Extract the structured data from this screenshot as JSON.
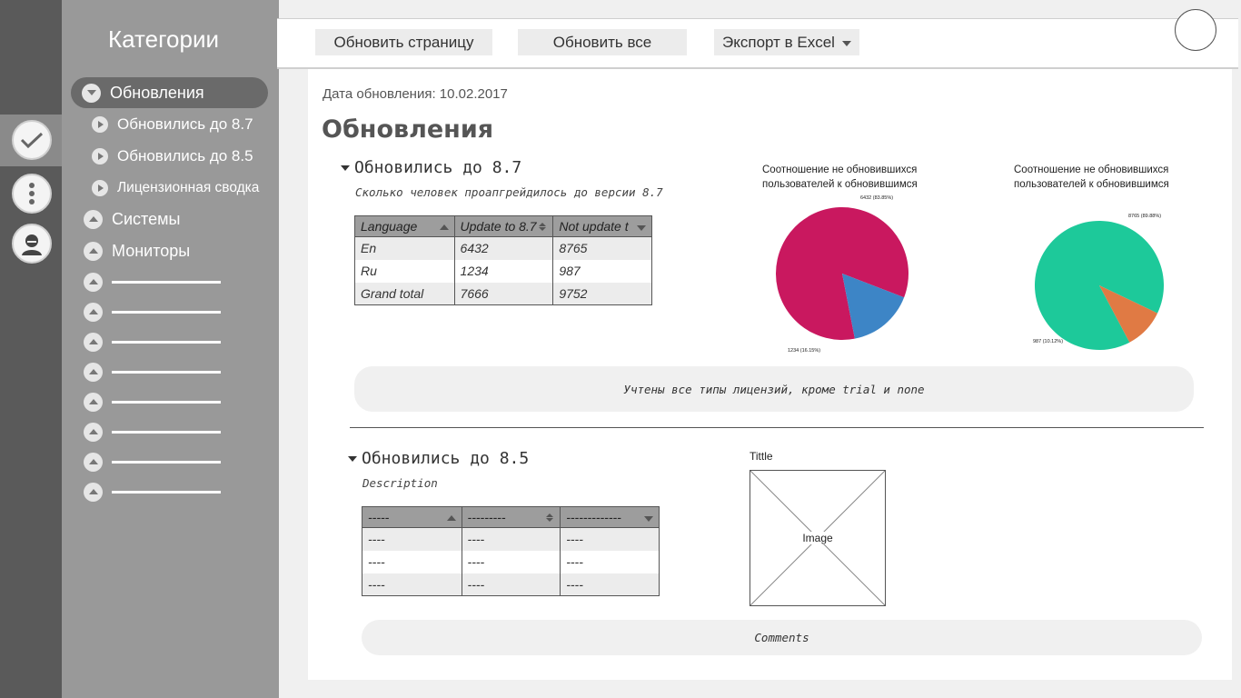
{
  "icons": {
    "rail": [
      "check-icon",
      "more-vertical-icon",
      "user-icon"
    ],
    "item_expanded": "chevron-down-icon",
    "item_collapsed": "chevron-up-icon",
    "sub_item": "chevron-right-icon"
  },
  "colors": {
    "pie_magenta": "#c9185f",
    "pie_blue": "#3d85c6",
    "pie_teal": "#1dc99a",
    "pie_orange": "#e07a44"
  },
  "sidebar": {
    "title": "Категории",
    "items": [
      {
        "label": "Обновления",
        "expanded": true,
        "active": true
      },
      {
        "label": "Обновились до 8.7",
        "sub": true
      },
      {
        "label": "Обновились до 8.5",
        "sub": true
      },
      {
        "label": "Лицензионная сводка",
        "sub": true
      },
      {
        "label": "Системы"
      },
      {
        "label": "Мониторы"
      }
    ],
    "placeholder_count": 8
  },
  "toolbar": {
    "refresh_page": "Обновить страницу",
    "refresh_all": "Обновить все",
    "export": "Экспорт в Excel"
  },
  "main": {
    "date": "Дата обновления: 10.02.2017",
    "title": "Обновления",
    "section1": {
      "heading": "Обновились до 8.7",
      "description": "Сколько человек проапгрейдилось до версии 8.7",
      "table": {
        "headers": [
          "Language",
          "Update to 8.7",
          "Not update t"
        ],
        "rows": [
          [
            "En",
            "6432",
            "8765"
          ],
          [
            "Ru",
            "1234",
            "987"
          ],
          [
            "Grand total",
            "7666",
            "9752"
          ]
        ]
      },
      "note": "Учтены все типы лицензий, кроме trial и none"
    },
    "section2": {
      "heading": "Обновились до 8.5",
      "description": "Description",
      "table": {
        "headers": [
          "-----",
          "---------",
          "-------------"
        ],
        "rows": [
          [
            "----",
            "----",
            "----"
          ],
          [
            "----",
            "----",
            "----"
          ],
          [
            "----",
            "----",
            "----"
          ]
        ]
      },
      "image_title": "Tittle",
      "image_label": "Image",
      "comments": "Comments"
    }
  },
  "chart_data": [
    {
      "type": "pie",
      "title": "Соотношение не обновившихся пользователей к обновившимся",
      "slices": [
        {
          "value": 6432,
          "label": "6432 (83.85%)",
          "color": "#c9185f"
        },
        {
          "value": 1234,
          "label": "1234 (16.15%)",
          "color": "#3d85c6"
        }
      ]
    },
    {
      "type": "pie",
      "title": "Соотношение не обновившихся пользователей к обновившимся",
      "slices": [
        {
          "value": 8765,
          "label": "8765 (89.88%)",
          "color": "#1dc99a"
        },
        {
          "value": 987,
          "label": "987 (10.12%)",
          "color": "#e07a44"
        }
      ]
    }
  ]
}
